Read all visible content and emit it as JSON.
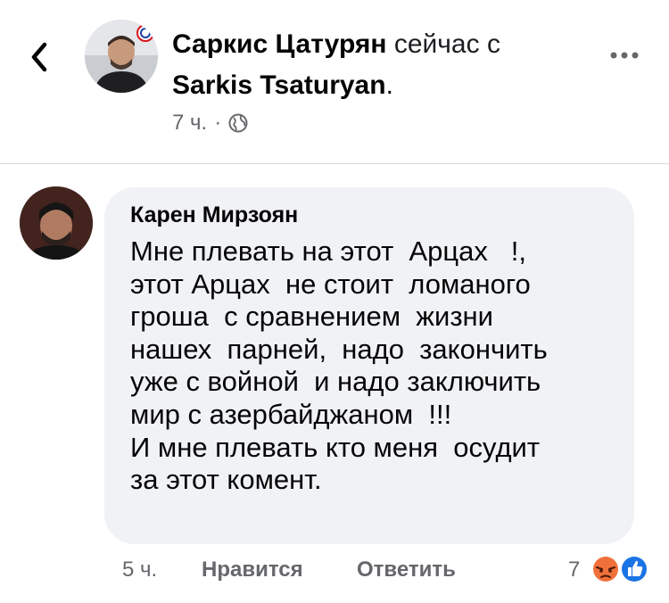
{
  "header": {
    "back_icon": "chevron-left-icon",
    "author": "Саркис Цатурян",
    "action": " сейчас с",
    "tagged": "Sarkis Tsaturyan",
    "tagged_suffix": ".",
    "time": "7 ч.",
    "separator": "·",
    "privacy_icon": "globe-icon",
    "more_icon": "more-horizontal-icon"
  },
  "comment": {
    "author": "Карен Мирзоян",
    "text": "Мне плевать на этот  Арцах   !,\nэтот Арцах  не стоит  ломаного\nгроша  с сравнением  жизни\nнашех  парней,  надо  закончить\nуже с войной  и надо заключить\nмир с азербайджаном  !!!\nИ мне плевать кто меня  осудит\nза этот комент."
  },
  "footer": {
    "time": "5 ч.",
    "like_label": "Нравится",
    "reply_label": "Ответить",
    "reaction_count": "7",
    "reaction_icons": [
      "angry-reaction-icon",
      "like-reaction-icon"
    ]
  },
  "colors": {
    "bubble": "#f0f2f5",
    "secondary_text": "#65676b",
    "like_blue": "#1b74e4",
    "angry_orange": "#f0703a"
  }
}
